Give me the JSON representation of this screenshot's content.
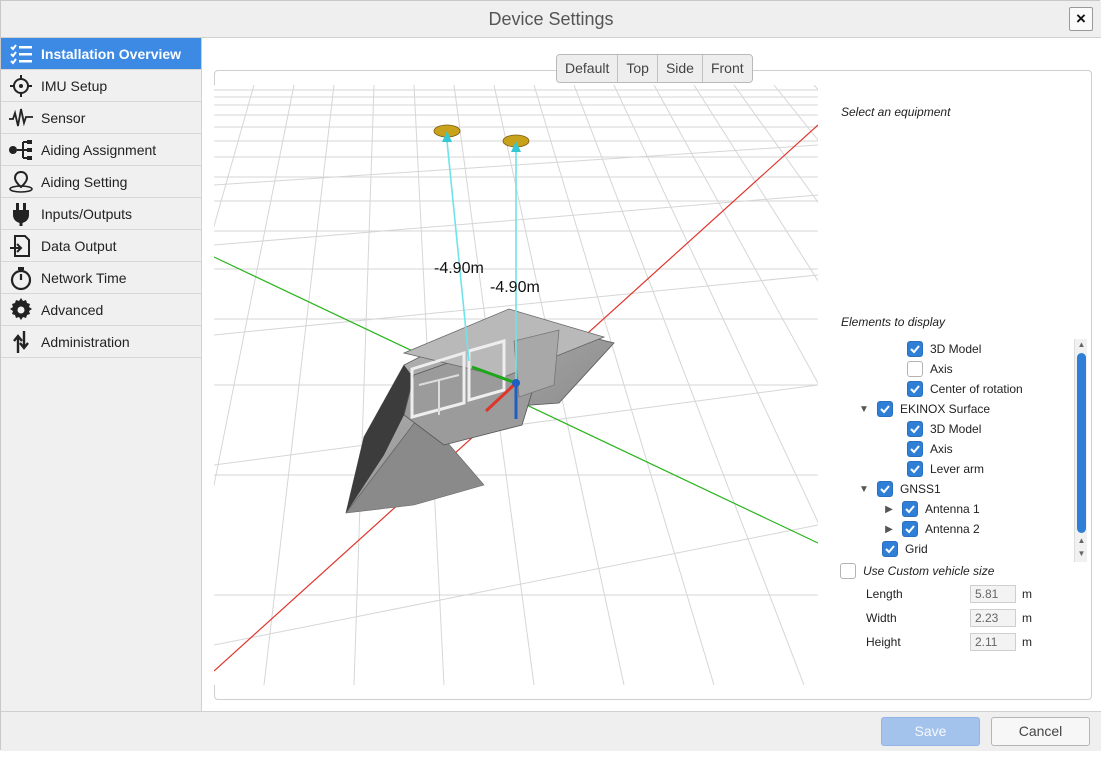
{
  "window": {
    "title": "Device Settings",
    "close_icon": "×"
  },
  "sidebar": {
    "items": [
      {
        "label": "Installation Overview",
        "icon": "checklist-icon",
        "active": true
      },
      {
        "label": "IMU Setup",
        "icon": "imu-icon"
      },
      {
        "label": "Sensor",
        "icon": "waveform-icon"
      },
      {
        "label": "Aiding Assignment",
        "icon": "aiding-assignment-icon"
      },
      {
        "label": "Aiding Setting",
        "icon": "aiding-setting-icon"
      },
      {
        "label": "Inputs/Outputs",
        "icon": "plug-icon"
      },
      {
        "label": "Data Output",
        "icon": "data-output-icon"
      },
      {
        "label": "Network Time",
        "icon": "stopwatch-icon"
      },
      {
        "label": "Advanced",
        "icon": "gear-icon"
      },
      {
        "label": "Administration",
        "icon": "administration-icon"
      }
    ]
  },
  "view_tabs": [
    "Default",
    "Top",
    "Side",
    "Front"
  ],
  "viewport": {
    "antenna1_offset": "-4.90m",
    "antenna2_offset": "-4.90m"
  },
  "right_panel": {
    "select_label": "Select an equipment",
    "elements_label": "Elements to display",
    "tree": [
      {
        "label": "3D Model",
        "checked": true,
        "level": 2
      },
      {
        "label": "Axis",
        "checked": false,
        "level": 2
      },
      {
        "label": "Center of rotation",
        "checked": true,
        "level": 2
      },
      {
        "label": "EKINOX Surface",
        "checked": true,
        "level": 1,
        "expanded": true
      },
      {
        "label": "3D Model",
        "checked": true,
        "level": 2
      },
      {
        "label": "Axis",
        "checked": true,
        "level": 2
      },
      {
        "label": "Lever arm",
        "checked": true,
        "level": 2
      },
      {
        "label": "GNSS1",
        "checked": true,
        "level": 1,
        "expanded": true
      },
      {
        "label": "Antenna 1",
        "checked": true,
        "level": 2,
        "collapsed": true
      },
      {
        "label": "Antenna 2",
        "checked": true,
        "level": 2,
        "collapsed": true
      },
      {
        "label": "Grid",
        "checked": true,
        "level": 1
      }
    ],
    "custom_size_label": "Use Custom vehicle size",
    "custom_size_checked": false,
    "dimensions": [
      {
        "label": "Length",
        "value": "5.81",
        "unit": "m"
      },
      {
        "label": "Width",
        "value": "2.23",
        "unit": "m"
      },
      {
        "label": "Height",
        "value": "2.11",
        "unit": "m"
      }
    ]
  },
  "footer": {
    "save_label": "Save",
    "cancel_label": "Cancel"
  },
  "colors": {
    "accent": "#3c8ae4",
    "checkbox": "#2f7fd6",
    "x_axis": "#e0352b",
    "y_axis": "#29b41d",
    "antenna_line": "#6fe3ea",
    "antenna_cap": "#c9a21c"
  }
}
